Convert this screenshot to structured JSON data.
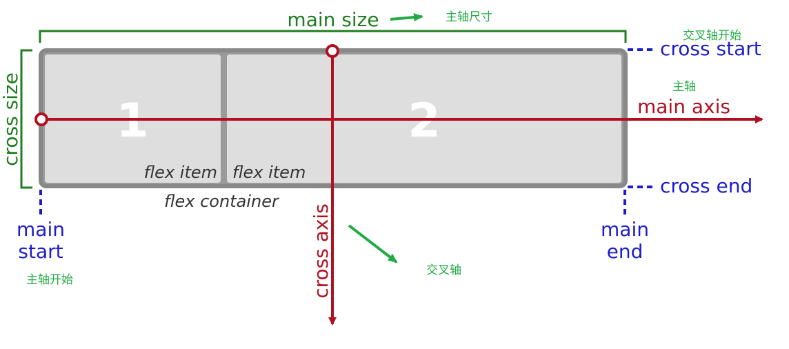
{
  "labels": {
    "main_size": "main size",
    "main_size_note": "主轴尺寸",
    "cross_start": "cross start",
    "cross_start_note": "交叉轴开始",
    "cross_end": "cross end",
    "cross_size": "cross size",
    "main_axis": "main axis",
    "main_axis_note": "主轴",
    "cross_axis": "cross axis",
    "cross_axis_note": "交叉轴",
    "main_start_line1": "main",
    "main_start_line2": "start",
    "main_start_note": "主轴开始",
    "main_end_line1": "main",
    "main_end_line2": "end",
    "flex_container": "flex container"
  },
  "items": [
    {
      "number": "1",
      "caption": "flex item"
    },
    {
      "number": "2",
      "caption": "flex item"
    }
  ],
  "colors": {
    "container_border": "#888888",
    "item_fill": "#dedede",
    "axis_red": "#b01020",
    "size_green": "#1e7d1e",
    "edge_blue": "#1c1ccc",
    "note_green": "#22aa44"
  }
}
